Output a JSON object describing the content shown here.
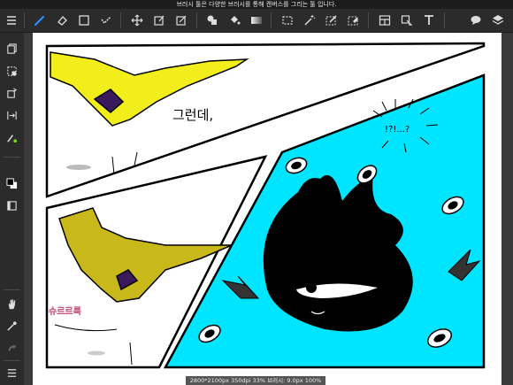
{
  "hint_text": "브러시 툴은 다양한 브러시를 통해 캔버스를 그리는 툴 입니다.",
  "status_text": "2800*2100px 350dpi 33% 브러시: 9.0px 100%",
  "artwork": {
    "speech_1": "그런데,",
    "speech_2": "!?!...?",
    "sfx": "슈르르륵"
  },
  "colors": {
    "cyan": "#00e5ff",
    "yellow": "#f2ee1c",
    "active_tool": "#2d8cff",
    "highlight_dot": "#7fd321"
  },
  "toolbar": {
    "icons": [
      "menu-icon",
      "brush-icon",
      "eraser-icon",
      "square-icon",
      "smudge-icon",
      "move-icon",
      "transform-icon",
      "distort-icon",
      "fill-shape-icon",
      "bucket-icon",
      "gradient-icon",
      "select-rect-icon",
      "magic-wand-icon",
      "select-pen-icon",
      "select-eraser-icon",
      "layout-icon",
      "select-move-icon",
      "text-icon",
      "speech-bubble-icon",
      "layers-icon"
    ]
  },
  "leftbar": {
    "icons": [
      "copy-icon",
      "select-all-icon",
      "rotate-icon",
      "flip-icon",
      "eyedropper-color-icon",
      "color-swatch-icon",
      "layer-panel-icon",
      "hand-icon",
      "eyedropper-icon",
      "redo-icon",
      "list-icon"
    ]
  }
}
